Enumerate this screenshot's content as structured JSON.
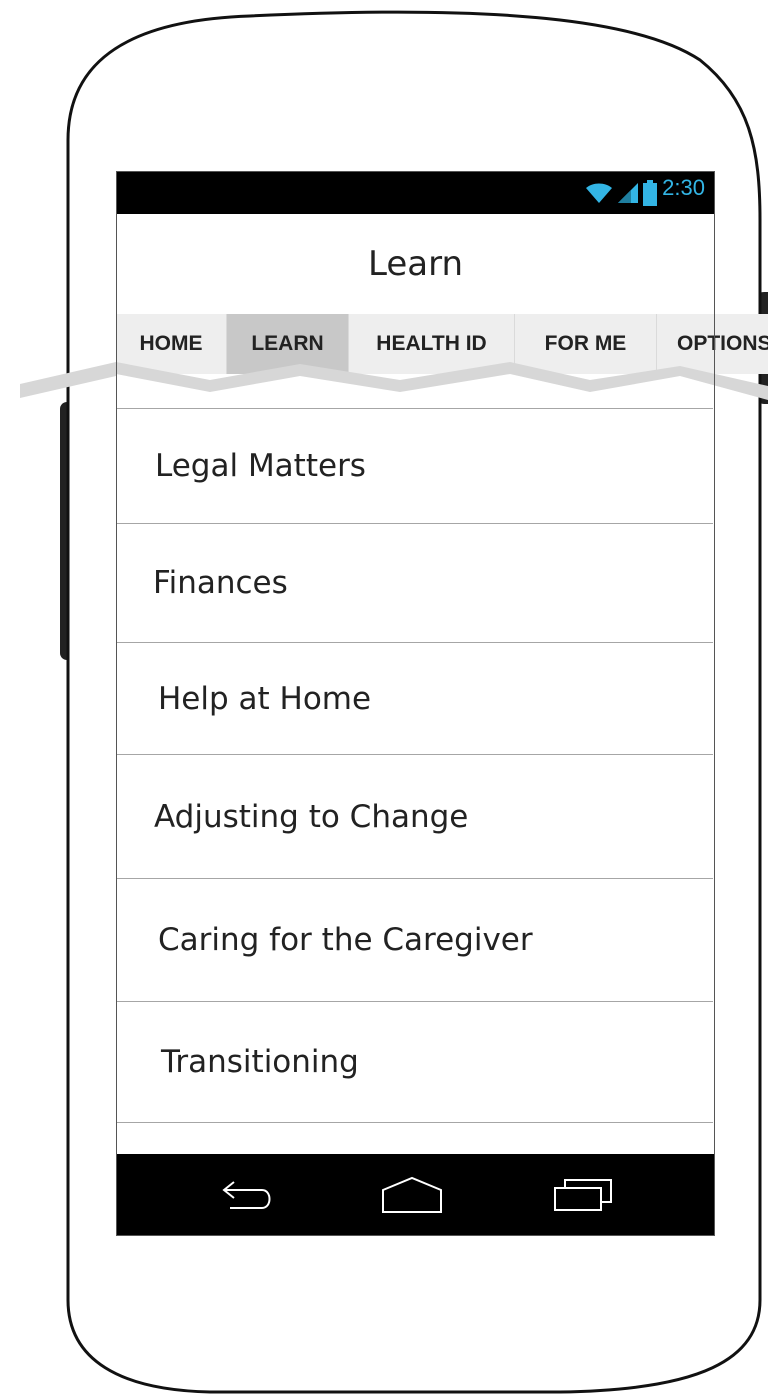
{
  "status_bar": {
    "time": "2:30",
    "icons": [
      "wifi-icon",
      "signal-icon",
      "battery-icon"
    ],
    "accent_color": "#33b5e5"
  },
  "action_bar": {
    "title": "Learn"
  },
  "tabs": [
    {
      "label": "HOME",
      "active": false
    },
    {
      "label": "LEARN",
      "active": true
    },
    {
      "label": "HEALTH ID",
      "active": false
    },
    {
      "label": "FOR ME",
      "active": false
    },
    {
      "label": "OPTIONS",
      "active": false
    }
  ],
  "list": {
    "items": [
      {
        "label": "Legal Matters"
      },
      {
        "label": "Finances"
      },
      {
        "label": "Help at Home"
      },
      {
        "label": "Adjusting to Change"
      },
      {
        "label": "Caring for the Caregiver"
      },
      {
        "label": "Transitioning"
      }
    ]
  },
  "nav_bar": {
    "buttons": [
      "back-icon",
      "home-icon",
      "recent-apps-icon"
    ]
  }
}
